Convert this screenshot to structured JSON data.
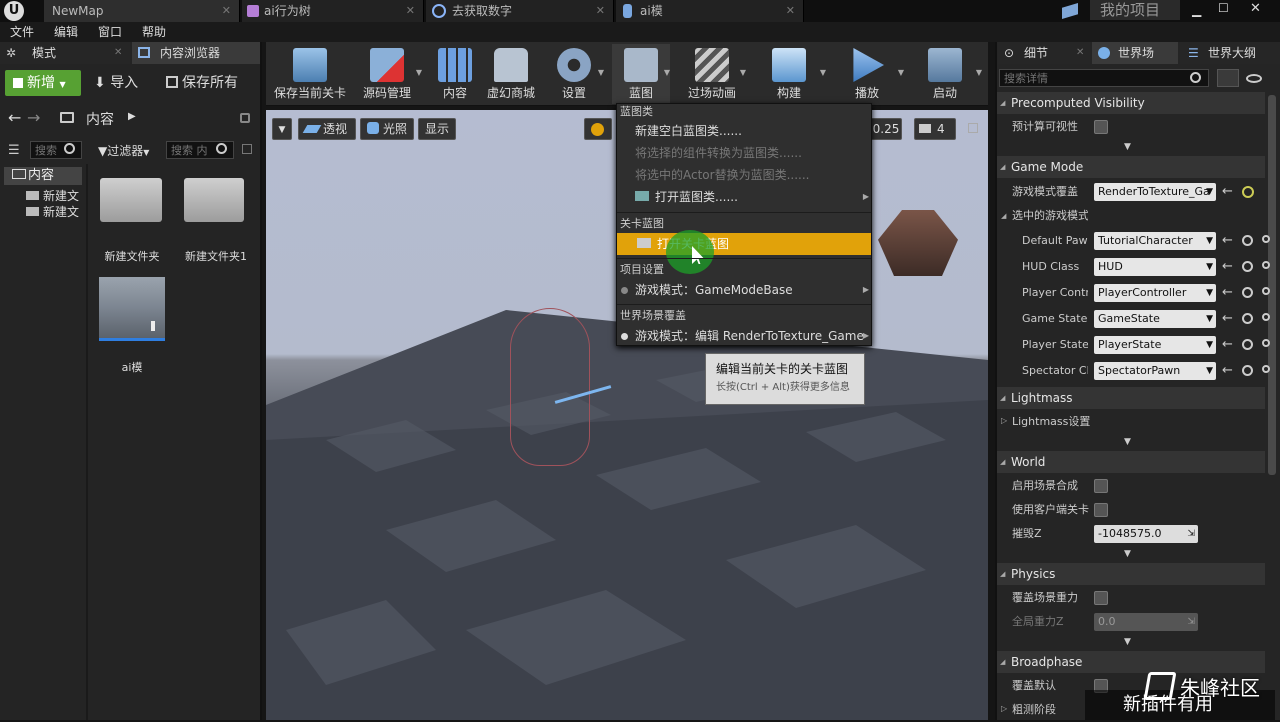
{
  "titlebar": {
    "tabs": [
      {
        "label": "NewMap"
      },
      {
        "label": "ai行为树"
      },
      {
        "label": "去获取数字"
      },
      {
        "label": "ai模"
      }
    ],
    "project_name": "我的项目"
  },
  "menubar": {
    "items": [
      "文件",
      "编辑",
      "窗口",
      "帮助"
    ]
  },
  "left_panel": {
    "tabs": [
      "模式",
      "内容浏览器"
    ],
    "add_new_label": "新增",
    "import_label": "导入",
    "save_all_label": "保存所有",
    "path_label": "内容",
    "search_placeholder": "搜索",
    "filter_label": "过滤器",
    "asset_search_placeholder": "搜索 内",
    "tree_root": "内容",
    "tree_children": [
      "新建文",
      "新建文"
    ],
    "assets": [
      {
        "label": "新建文件夹"
      },
      {
        "label": "新建文件夹1"
      },
      {
        "label": "ai模"
      }
    ]
  },
  "toolbar": {
    "buttons": [
      {
        "label": "保存当前关卡"
      },
      {
        "label": "源码管理"
      },
      {
        "label": "内容"
      },
      {
        "label": "虚幻商城"
      },
      {
        "label": "设置"
      },
      {
        "label": "蓝图"
      },
      {
        "label": "过场动画"
      },
      {
        "label": "构建"
      },
      {
        "label": "播放"
      },
      {
        "label": "启动"
      }
    ]
  },
  "viewport": {
    "perspective_label": "透视",
    "lit_label": "光照",
    "show_label": "显示",
    "snap_value": "0.25",
    "camera_speed": "4"
  },
  "blueprint_menu": {
    "sections": [
      {
        "header": "蓝图类",
        "items": [
          {
            "label": "新建空白蓝图类......",
            "enabled": true
          },
          {
            "label": "将选择的组件转换为蓝图类......",
            "enabled": false
          },
          {
            "label": "将选中的Actor替换为蓝图类......",
            "enabled": false
          },
          {
            "label": "打开蓝图类......",
            "enabled": true
          }
        ]
      },
      {
        "header": "关卡蓝图",
        "items": [
          {
            "label": "打开关卡蓝图",
            "enabled": true,
            "highlighted": true
          }
        ]
      },
      {
        "header": "项目设置",
        "items": [
          {
            "label": "游戏模式：GameModeBase",
            "enabled": true
          }
        ]
      },
      {
        "header": "世界场景覆盖",
        "items": [
          {
            "label": "游戏模式：编辑 RenderToTexture_Game",
            "enabled": true
          }
        ]
      }
    ],
    "tooltip": {
      "title": "编辑当前关卡的关卡蓝图",
      "hint": "长按(Ctrl + Alt)获得更多信息"
    },
    "highlight_color": "#e1a20a"
  },
  "right_panel": {
    "tabs": [
      "细节",
      "世界场",
      "世界大纲"
    ],
    "search_placeholder": "搜索详情",
    "sections": {
      "precomputed_visibility": {
        "title": "Precomputed Visibility",
        "rows": [
          {
            "label": "预计算可视性"
          }
        ]
      },
      "game_mode": {
        "title": "Game Mode",
        "override_label": "游戏模式覆盖",
        "override_value": "RenderToTexture_Ga",
        "selected_label": "选中的游戏模式",
        "rows": [
          {
            "label": "Default Pawn",
            "value": "TutorialCharacter"
          },
          {
            "label": "HUD Class",
            "value": "HUD"
          },
          {
            "label": "Player Contro",
            "value": "PlayerController"
          },
          {
            "label": "Game State C",
            "value": "GameState"
          },
          {
            "label": "Player State",
            "value": "PlayerState"
          },
          {
            "label": "Spectator Cla",
            "value": "SpectatorPawn"
          }
        ]
      },
      "lightmass": {
        "title": "Lightmass",
        "rows": [
          {
            "label": "Lightmass设置"
          }
        ]
      },
      "world": {
        "title": "World",
        "rows": [
          {
            "label": "启用场景合成"
          },
          {
            "label": "使用客户端关卡"
          },
          {
            "label": "摧毁Z",
            "value": "-1048575.0"
          }
        ]
      },
      "physics": {
        "title": "Physics",
        "rows": [
          {
            "label": "覆盖场景重力"
          },
          {
            "label": "全局重力Z",
            "value": "0.0"
          }
        ]
      },
      "broadphase": {
        "title": "Broadphase",
        "rows": [
          {
            "label": "覆盖默认"
          },
          {
            "label": "粗测阶段"
          }
        ]
      }
    }
  },
  "watermark": {
    "brand": "朱峰社区",
    "overlay": "新插件有用"
  }
}
